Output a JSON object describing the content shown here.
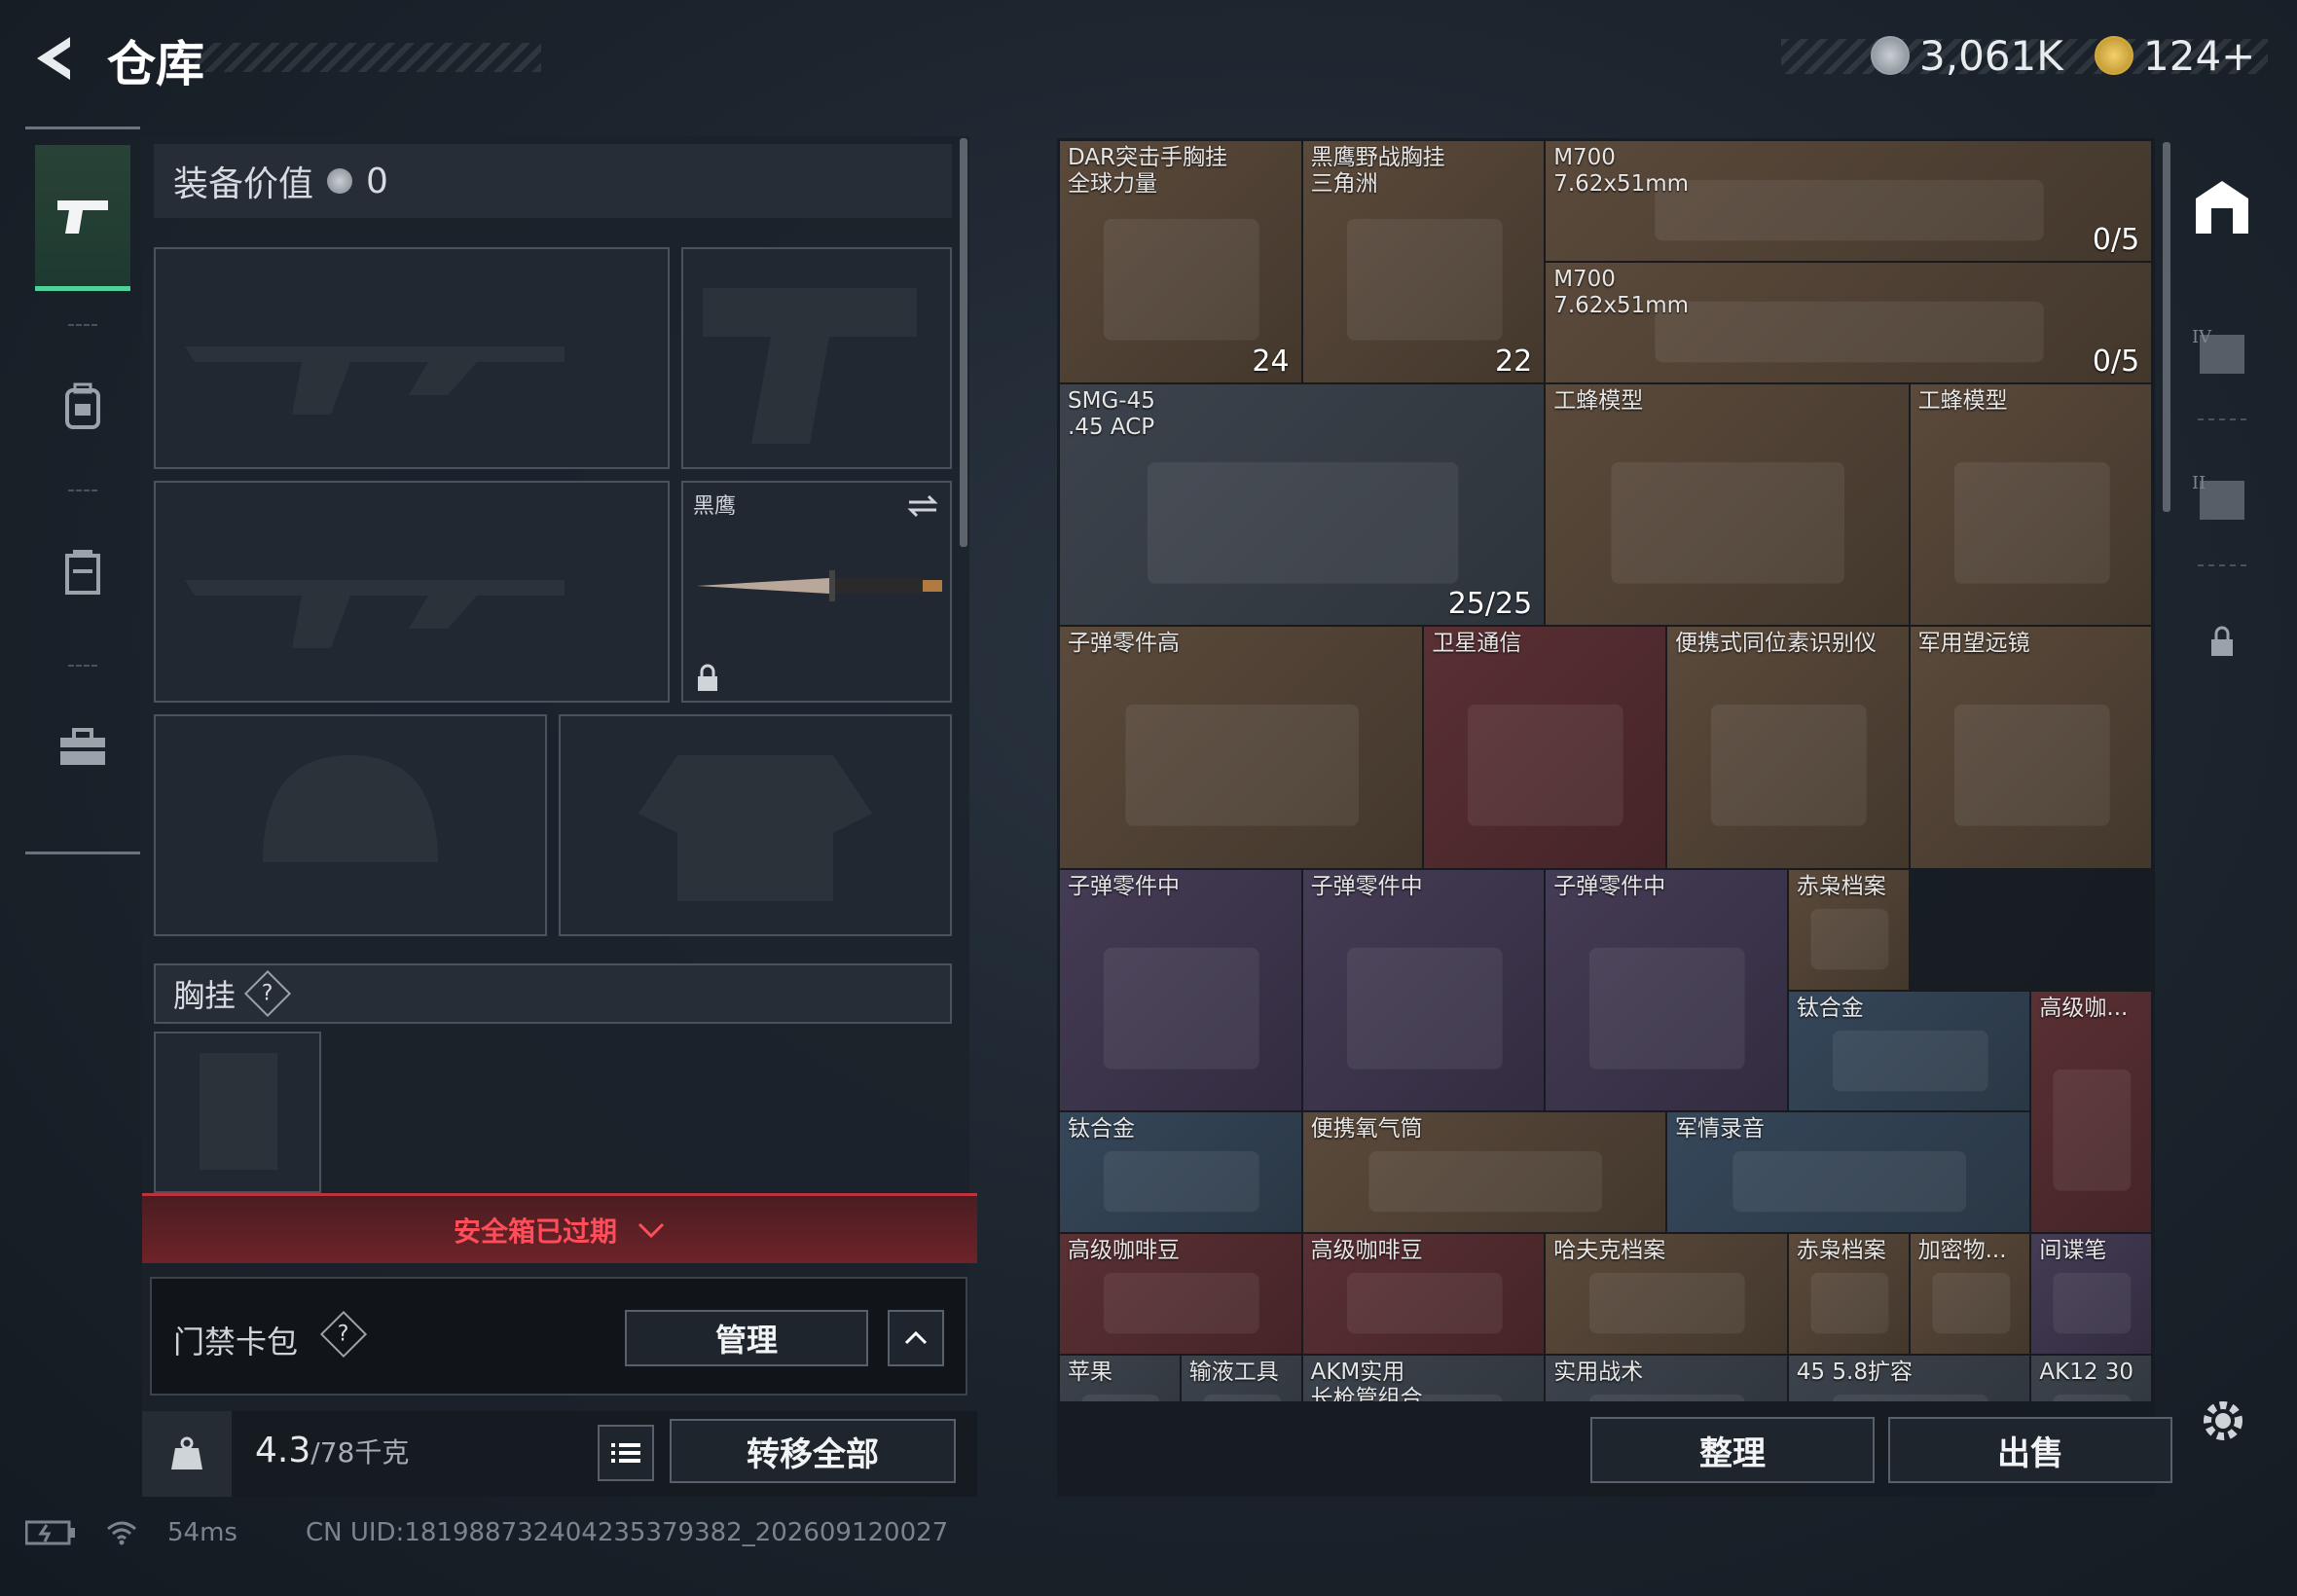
{
  "header": {
    "title": "仓库",
    "currency_silver": "3,061K",
    "currency_gold": "124+"
  },
  "nav": {
    "items": [
      "weapons",
      "backpack",
      "chest-rig",
      "toolbox"
    ]
  },
  "loadout": {
    "equipment_value_label": "装备价值",
    "equipment_value": "0",
    "melee_label": "黑鹰",
    "chest_rig_label": "胸挂",
    "help_mark": "?"
  },
  "safebox": {
    "status": "安全箱已过期"
  },
  "keycard": {
    "label": "门禁卡包",
    "help_mark": "?",
    "manage_button": "管理"
  },
  "capacity": {
    "value": "4.3",
    "max": "/78千克",
    "transfer_all_button": "转移全部"
  },
  "storage": {
    "items": [
      {
        "name": "DAR突击手胸挂\n全球力量",
        "count": "24",
        "bg": "brown"
      },
      {
        "name": "黑鹰野战胸挂\n三角洲",
        "count": "22",
        "bg": "brown"
      },
      {
        "name": "M700\n7.62x51mm",
        "count": "0/5",
        "bg": "brown"
      },
      {
        "name": "M700\n7.62x51mm",
        "count": "0/5",
        "bg": "brown"
      },
      {
        "name": "SMG-45\n.45 ACP",
        "count": "25/25",
        "bg": "gray"
      },
      {
        "name": "工蜂模型",
        "count": "",
        "bg": "brown"
      },
      {
        "name": "工蜂模型",
        "count": "",
        "bg": "brown"
      },
      {
        "name": "子弹零件高",
        "count": "",
        "bg": "brown"
      },
      {
        "name": "卫星通信",
        "count": "",
        "bg": "red"
      },
      {
        "name": "便携式同位素识别仪",
        "count": "",
        "bg": "brown"
      },
      {
        "name": "军用望远镜",
        "count": "",
        "bg": "brown"
      },
      {
        "name": "子弹零件中",
        "count": "",
        "bg": "purple"
      },
      {
        "name": "子弹零件中",
        "count": "",
        "bg": "purple"
      },
      {
        "name": "子弹零件中",
        "count": "",
        "bg": "purple"
      },
      {
        "name": "赤枭档案",
        "count": "",
        "bg": "brown"
      },
      {
        "name": "钛合金",
        "count": "",
        "bg": "blue"
      },
      {
        "name": "高级咖...",
        "count": "",
        "bg": "red"
      },
      {
        "name": "钛合金",
        "count": "",
        "bg": "blue"
      },
      {
        "name": "便携氧气筒",
        "count": "",
        "bg": "brown"
      },
      {
        "name": "军情录音",
        "count": "",
        "bg": "blue"
      },
      {
        "name": "高级咖啡豆",
        "count": "",
        "bg": "red"
      },
      {
        "name": "高级咖啡豆",
        "count": "",
        "bg": "red"
      },
      {
        "name": "哈夫克档案",
        "count": "",
        "bg": "brown"
      },
      {
        "name": "赤枭档案",
        "count": "",
        "bg": "brown"
      },
      {
        "name": "加密物...",
        "count": "",
        "bg": "brown"
      },
      {
        "name": "间谍笔",
        "count": "",
        "bg": "purple"
      },
      {
        "name": "苹果",
        "count": "",
        "bg": "gray"
      },
      {
        "name": "输液工具",
        "count": "",
        "bg": "gray"
      },
      {
        "name": "AKM实用\n长枪管组合",
        "count": "",
        "bg": "gray"
      },
      {
        "name": "实用战术",
        "count": "",
        "bg": "gray"
      },
      {
        "name": "45 5.8扩容",
        "count": "",
        "bg": "gray"
      },
      {
        "name": "AK12 30",
        "count": "",
        "bg": "gray"
      }
    ],
    "sort_button": "整理",
    "sell_button": "出售"
  },
  "footer": {
    "ping": "54ms",
    "uid": "CN UID:181988732404235379382_202609120027"
  },
  "colors": {
    "accent_green": "#4ed29c",
    "alert_red": "#ff4d5a",
    "brown": "#5b4a3b",
    "purple": "#453c55",
    "red": "#5a3034",
    "blue": "#35475a"
  }
}
